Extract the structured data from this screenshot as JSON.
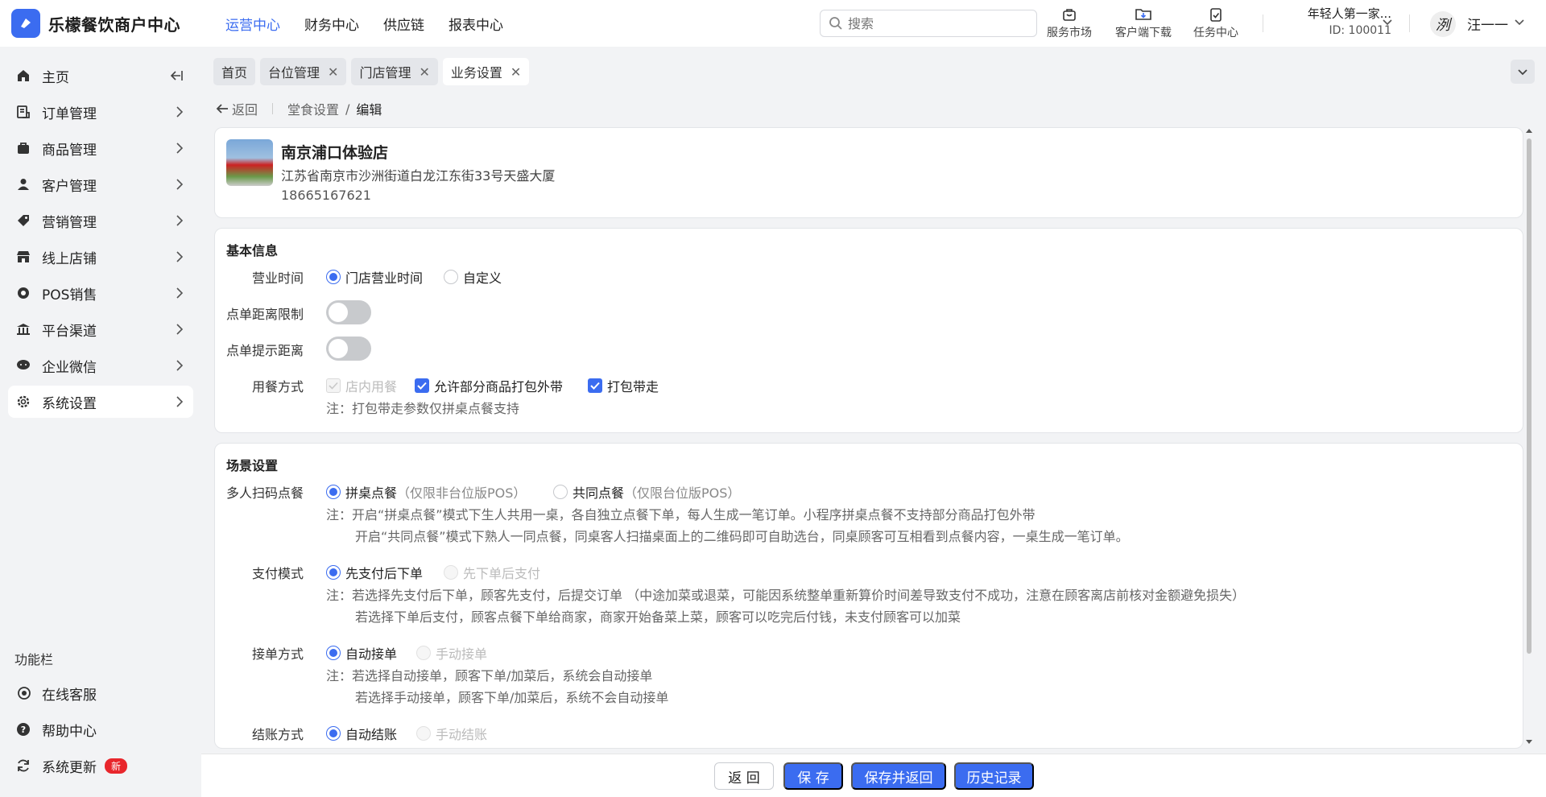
{
  "app": {
    "brand": "乐檬餐饮商户中心",
    "accent": "#3b6cf0"
  },
  "topnav": [
    {
      "label": "运营中心",
      "active": true
    },
    {
      "label": "财务中心"
    },
    {
      "label": "供应链"
    },
    {
      "label": "报表中心"
    }
  ],
  "search": {
    "placeholder": "搜索"
  },
  "tools": {
    "market": "服务市场",
    "download": "客户端下载",
    "tasks": "任务中心"
  },
  "account": {
    "name": "年轻人第一家...",
    "id": "ID: 100011",
    "user": "汪一一",
    "avatar_char": "洌"
  },
  "sidebar": {
    "items": [
      {
        "label": "主页",
        "icon": "home-icon"
      },
      {
        "label": "订单管理",
        "icon": "order-icon"
      },
      {
        "label": "商品管理",
        "icon": "goods-icon"
      },
      {
        "label": "客户管理",
        "icon": "user-icon"
      },
      {
        "label": "营销管理",
        "icon": "tag-icon"
      },
      {
        "label": "线上店铺",
        "icon": "store-icon"
      },
      {
        "label": "POS销售",
        "icon": "pos-icon"
      },
      {
        "label": "平台渠道",
        "icon": "bank-icon"
      },
      {
        "label": "企业微信",
        "icon": "chat-icon"
      },
      {
        "label": "系统设置",
        "icon": "gear-icon",
        "active": true
      }
    ],
    "section_title": "功能栏",
    "fn_items": [
      {
        "label": "在线客服"
      },
      {
        "label": "帮助中心"
      },
      {
        "label": "系统更新",
        "badge": "新"
      }
    ]
  },
  "tabs": [
    {
      "label": "首页"
    },
    {
      "label": "台位管理"
    },
    {
      "label": "门店管理"
    },
    {
      "label": "业务设置",
      "active": true
    }
  ],
  "breadcrumb": {
    "back": "返回",
    "parent": "堂食设置",
    "sep": "/",
    "current": "编辑"
  },
  "store": {
    "name": "南京浦口体验店",
    "address": "江苏省南京市沙洲街道白龙江东街33号天盛大厦",
    "phone": "18665167621"
  },
  "basic": {
    "title": "基本信息",
    "hours_label": "营业时间",
    "hours_opt1": "门店营业时间",
    "hours_opt2": "自定义",
    "dist_limit_label": "点单距离限制",
    "dist_hint_label": "点单提示距离",
    "dining_label": "用餐方式",
    "dining_opt1": "店内用餐",
    "dining_opt2": "允许部分商品打包外带",
    "dining_opt3": "打包带走",
    "dining_note": "注：打包带走参数仅拼桌点餐支持"
  },
  "scene": {
    "title": "场景设置",
    "multi_label": "多人扫码点餐",
    "multi_opt1": "拼桌点餐",
    "multi_opt1_hint": "（仅限非台位版POS）",
    "multi_opt2": "共同点餐",
    "multi_opt2_hint": "（仅限台位版POS）",
    "multi_note1": "注：开启“拼桌点餐”模式下生人共用一桌，各自独立点餐下单，每人生成一笔订单。小程序拼桌点餐不支持部分商品打包外带",
    "multi_note2": "开启“共同点餐”模式下熟人一同点餐，同桌客人扫描桌面上的二维码即可自助选台，同桌顾客可互相看到点餐内容，一桌生成一笔订单。",
    "pay_label": "支付模式",
    "pay_opt1": "先支付后下单",
    "pay_opt2": "先下单后支付",
    "pay_note1": "注：若选择先支付后下单，顾客先支付，后提交订单 （中途加菜或退菜，可能因系统整单重新算价时间差导致支付不成功，注意在顾客离店前核对金额避免损失）",
    "pay_note2": "若选择下单后支付，顾客点餐下单给商家，商家开始备菜上菜，顾客可以吃完后付钱，未支付顾客可以加菜",
    "accept_label": "接单方式",
    "accept_opt1": "自动接单",
    "accept_opt2": "手动接单",
    "accept_note1": "注：若选择自动接单，顾客下单/加菜后，系统会自动接单",
    "accept_note2": "若选择手动接单，顾客下单/加菜后，系统不会自动接单",
    "checkout_label": "结账方式",
    "checkout_opt1": "自动结账",
    "checkout_opt2": "手动结账"
  },
  "footer": {
    "back": "返 回",
    "save": "保 存",
    "save_back": "保存并返回",
    "history": "历史记录"
  }
}
